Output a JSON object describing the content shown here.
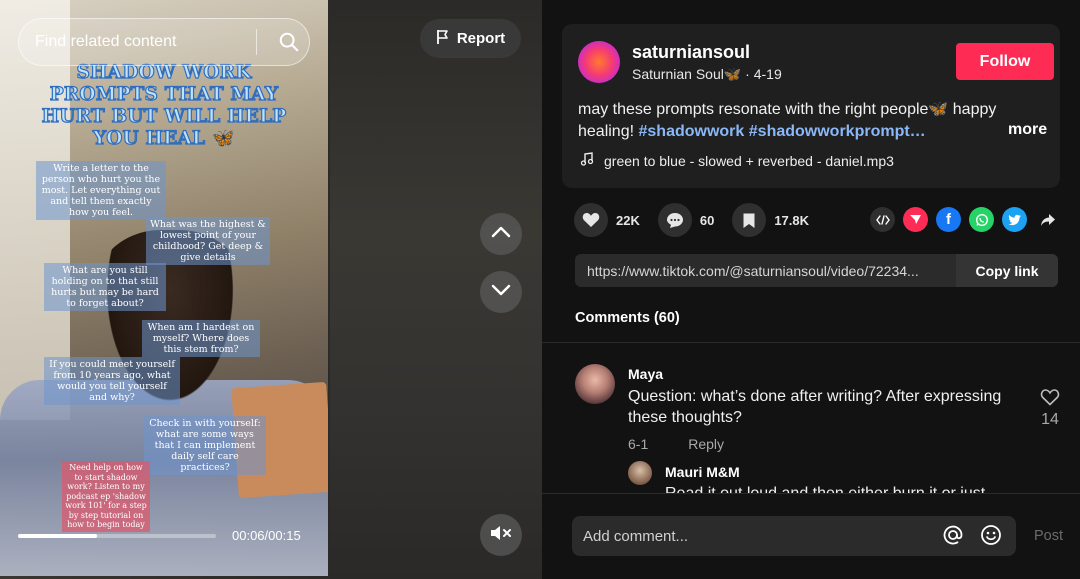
{
  "video": {
    "search_placeholder": "Find related content",
    "title_overlay": "SHADOW WORK PROMPTS THAT MAY HURT BUT WILL HELP YOU HEAL 🦋",
    "prompts": [
      "Write a letter to the person who hurt you the most. Let everything out and tell them exactly how you feel.",
      "What was the highest & lowest point of your childhood? Get deep & give details",
      "What are you still holding on to that still hurts but may be hard to forget about?",
      "When am I hardest on myself? Where does this stem from?",
      "If you could meet yourself from 10 years ago, what would you tell yourself and why?",
      "Check in with yourself: what are some ways that I can implement daily self care practices?",
      "Need help on how to start shadow work? Listen to my podcast ep 'shadow work 101' for a step by step tutorial on how to begin today"
    ],
    "time": "00:06/00:15",
    "progress_fraction": 0.4,
    "report_label": "Report"
  },
  "author": {
    "username": "saturniansoul",
    "nickname": "Saturnian Soul🦋",
    "date": "4-19",
    "follow_label": "Follow"
  },
  "caption": {
    "text": "may these prompts resonate with the right people🦋  happy healing!",
    "tags": [
      "#shadowwork",
      "#shadowworkprompt…"
    ],
    "more_label": "more"
  },
  "music": {
    "title": "green to blue - slowed + reverbed - daniel.mp3"
  },
  "stats": {
    "likes": "22K",
    "comments": "60",
    "saves": "17.8K"
  },
  "share": {
    "url": "https://www.tiktok.com/@saturniansoul/video/72234...",
    "copy_label": "Copy link"
  },
  "comments_section": {
    "heading": "Comments (60)",
    "items": [
      {
        "name": "Maya",
        "text": "Question: what’s done after writing? After expressing these thoughts?",
        "date": "6-1",
        "reply_label": "Reply",
        "likes": "14"
      },
      {
        "name": "Mauri M&M",
        "text": "Read it out loud and then either burn it or just"
      }
    ]
  },
  "input": {
    "placeholder": "Add comment...",
    "post_label": "Post"
  },
  "colors": {
    "accent": "#fe2c55",
    "hashtag": "#8ab8f7"
  }
}
